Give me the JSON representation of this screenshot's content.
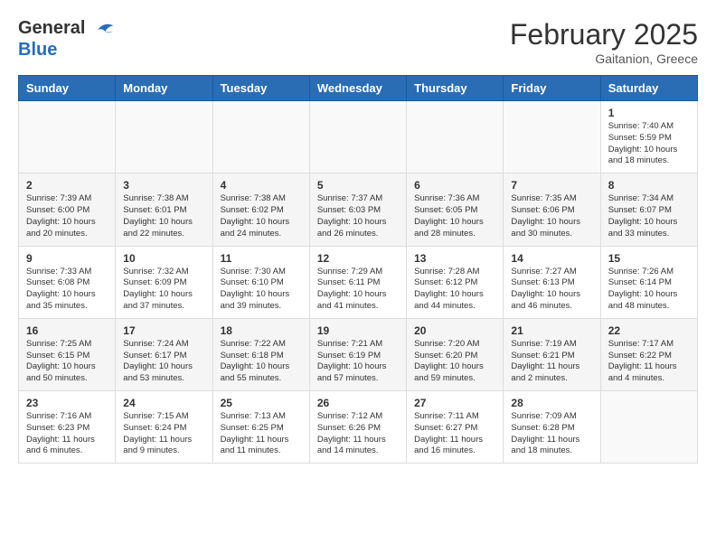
{
  "header": {
    "logo_general": "General",
    "logo_blue": "Blue",
    "month_year": "February 2025",
    "location": "Gaitanion, Greece"
  },
  "weekdays": [
    "Sunday",
    "Monday",
    "Tuesday",
    "Wednesday",
    "Thursday",
    "Friday",
    "Saturday"
  ],
  "weeks": [
    {
      "row_type": "odd",
      "days": [
        {
          "num": "",
          "info": ""
        },
        {
          "num": "",
          "info": ""
        },
        {
          "num": "",
          "info": ""
        },
        {
          "num": "",
          "info": ""
        },
        {
          "num": "",
          "info": ""
        },
        {
          "num": "",
          "info": ""
        },
        {
          "num": "1",
          "info": "Sunrise: 7:40 AM\nSunset: 5:59 PM\nDaylight: 10 hours\nand 18 minutes."
        }
      ]
    },
    {
      "row_type": "even",
      "days": [
        {
          "num": "2",
          "info": "Sunrise: 7:39 AM\nSunset: 6:00 PM\nDaylight: 10 hours\nand 20 minutes."
        },
        {
          "num": "3",
          "info": "Sunrise: 7:38 AM\nSunset: 6:01 PM\nDaylight: 10 hours\nand 22 minutes."
        },
        {
          "num": "4",
          "info": "Sunrise: 7:38 AM\nSunset: 6:02 PM\nDaylight: 10 hours\nand 24 minutes."
        },
        {
          "num": "5",
          "info": "Sunrise: 7:37 AM\nSunset: 6:03 PM\nDaylight: 10 hours\nand 26 minutes."
        },
        {
          "num": "6",
          "info": "Sunrise: 7:36 AM\nSunset: 6:05 PM\nDaylight: 10 hours\nand 28 minutes."
        },
        {
          "num": "7",
          "info": "Sunrise: 7:35 AM\nSunset: 6:06 PM\nDaylight: 10 hours\nand 30 minutes."
        },
        {
          "num": "8",
          "info": "Sunrise: 7:34 AM\nSunset: 6:07 PM\nDaylight: 10 hours\nand 33 minutes."
        }
      ]
    },
    {
      "row_type": "odd",
      "days": [
        {
          "num": "9",
          "info": "Sunrise: 7:33 AM\nSunset: 6:08 PM\nDaylight: 10 hours\nand 35 minutes."
        },
        {
          "num": "10",
          "info": "Sunrise: 7:32 AM\nSunset: 6:09 PM\nDaylight: 10 hours\nand 37 minutes."
        },
        {
          "num": "11",
          "info": "Sunrise: 7:30 AM\nSunset: 6:10 PM\nDaylight: 10 hours\nand 39 minutes."
        },
        {
          "num": "12",
          "info": "Sunrise: 7:29 AM\nSunset: 6:11 PM\nDaylight: 10 hours\nand 41 minutes."
        },
        {
          "num": "13",
          "info": "Sunrise: 7:28 AM\nSunset: 6:12 PM\nDaylight: 10 hours\nand 44 minutes."
        },
        {
          "num": "14",
          "info": "Sunrise: 7:27 AM\nSunset: 6:13 PM\nDaylight: 10 hours\nand 46 minutes."
        },
        {
          "num": "15",
          "info": "Sunrise: 7:26 AM\nSunset: 6:14 PM\nDaylight: 10 hours\nand 48 minutes."
        }
      ]
    },
    {
      "row_type": "even",
      "days": [
        {
          "num": "16",
          "info": "Sunrise: 7:25 AM\nSunset: 6:15 PM\nDaylight: 10 hours\nand 50 minutes."
        },
        {
          "num": "17",
          "info": "Sunrise: 7:24 AM\nSunset: 6:17 PM\nDaylight: 10 hours\nand 53 minutes."
        },
        {
          "num": "18",
          "info": "Sunrise: 7:22 AM\nSunset: 6:18 PM\nDaylight: 10 hours\nand 55 minutes."
        },
        {
          "num": "19",
          "info": "Sunrise: 7:21 AM\nSunset: 6:19 PM\nDaylight: 10 hours\nand 57 minutes."
        },
        {
          "num": "20",
          "info": "Sunrise: 7:20 AM\nSunset: 6:20 PM\nDaylight: 10 hours\nand 59 minutes."
        },
        {
          "num": "21",
          "info": "Sunrise: 7:19 AM\nSunset: 6:21 PM\nDaylight: 11 hours\nand 2 minutes."
        },
        {
          "num": "22",
          "info": "Sunrise: 7:17 AM\nSunset: 6:22 PM\nDaylight: 11 hours\nand 4 minutes."
        }
      ]
    },
    {
      "row_type": "odd",
      "days": [
        {
          "num": "23",
          "info": "Sunrise: 7:16 AM\nSunset: 6:23 PM\nDaylight: 11 hours\nand 6 minutes."
        },
        {
          "num": "24",
          "info": "Sunrise: 7:15 AM\nSunset: 6:24 PM\nDaylight: 11 hours\nand 9 minutes."
        },
        {
          "num": "25",
          "info": "Sunrise: 7:13 AM\nSunset: 6:25 PM\nDaylight: 11 hours\nand 11 minutes."
        },
        {
          "num": "26",
          "info": "Sunrise: 7:12 AM\nSunset: 6:26 PM\nDaylight: 11 hours\nand 14 minutes."
        },
        {
          "num": "27",
          "info": "Sunrise: 7:11 AM\nSunset: 6:27 PM\nDaylight: 11 hours\nand 16 minutes."
        },
        {
          "num": "28",
          "info": "Sunrise: 7:09 AM\nSunset: 6:28 PM\nDaylight: 11 hours\nand 18 minutes."
        },
        {
          "num": "",
          "info": ""
        }
      ]
    }
  ]
}
